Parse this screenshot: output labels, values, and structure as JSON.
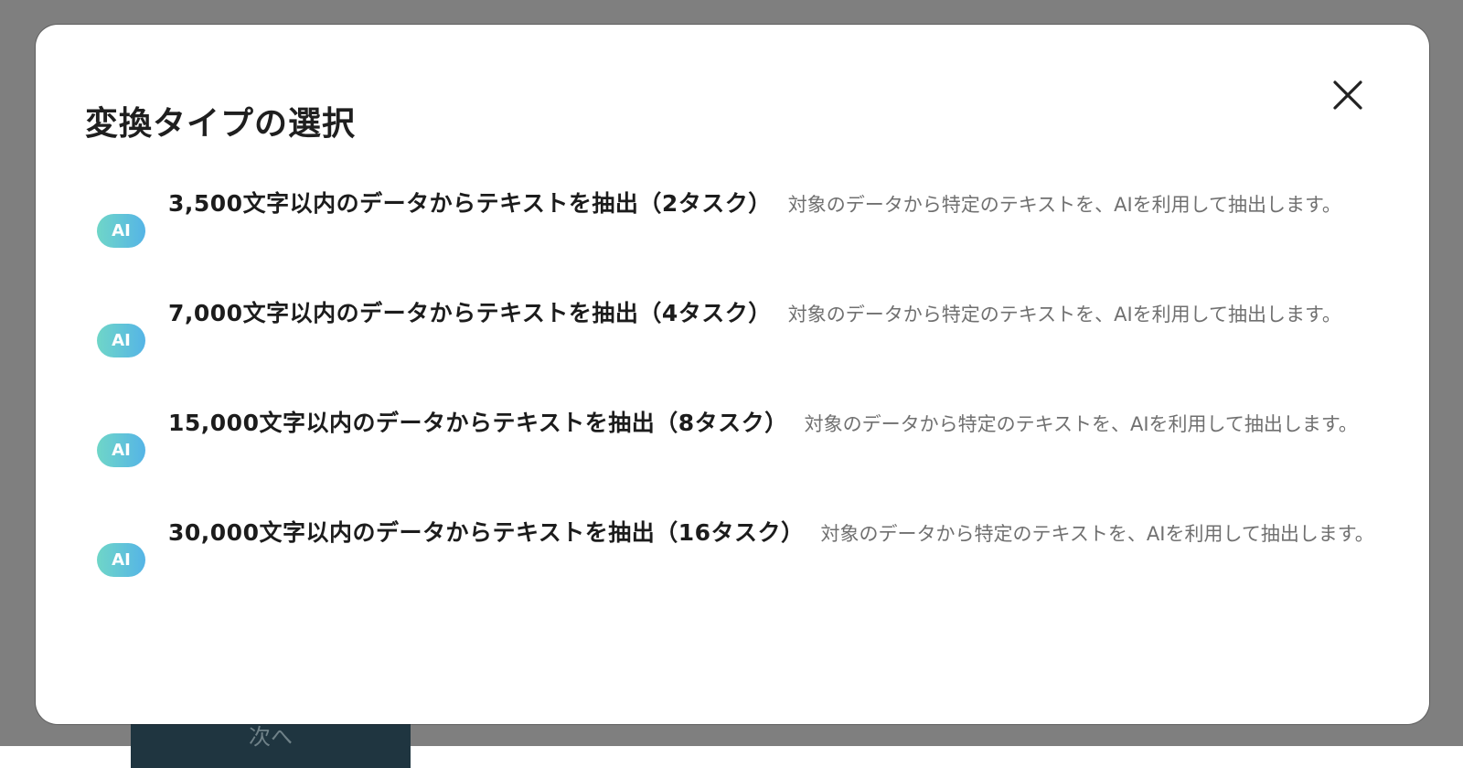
{
  "background": {
    "next_button_label": "次へ"
  },
  "modal": {
    "title": "変換タイプの選択",
    "close_icon": "close-icon",
    "options": [
      {
        "badge": "AI",
        "label": "3,500文字以内のデータからテキストを抽出（2タスク）",
        "description": "対象のデータから特定のテキストを、AIを利用して抽出します。"
      },
      {
        "badge": "AI",
        "label": "7,000文字以内のデータからテキストを抽出（4タスク）",
        "description": "対象のデータから特定のテキストを、AIを利用して抽出します。"
      },
      {
        "badge": "AI",
        "label": "15,000文字以内のデータからテキストを抽出（8タスク）",
        "description": "対象のデータから特定のテキストを、AIを利用して抽出します。"
      },
      {
        "badge": "AI",
        "label": "30,000文字以内のデータからテキストを抽出（16タスク）",
        "description": "対象のデータから特定のテキストを、AIを利用して抽出します。"
      }
    ]
  },
  "colors": {
    "overlay": "#7f7f7f",
    "modal_background": "#ffffff",
    "badge_gradient_start": "#6fd6c8",
    "badge_gradient_end": "#55b4e6",
    "label_text": "#1c1c1c",
    "description_text": "#707070"
  }
}
